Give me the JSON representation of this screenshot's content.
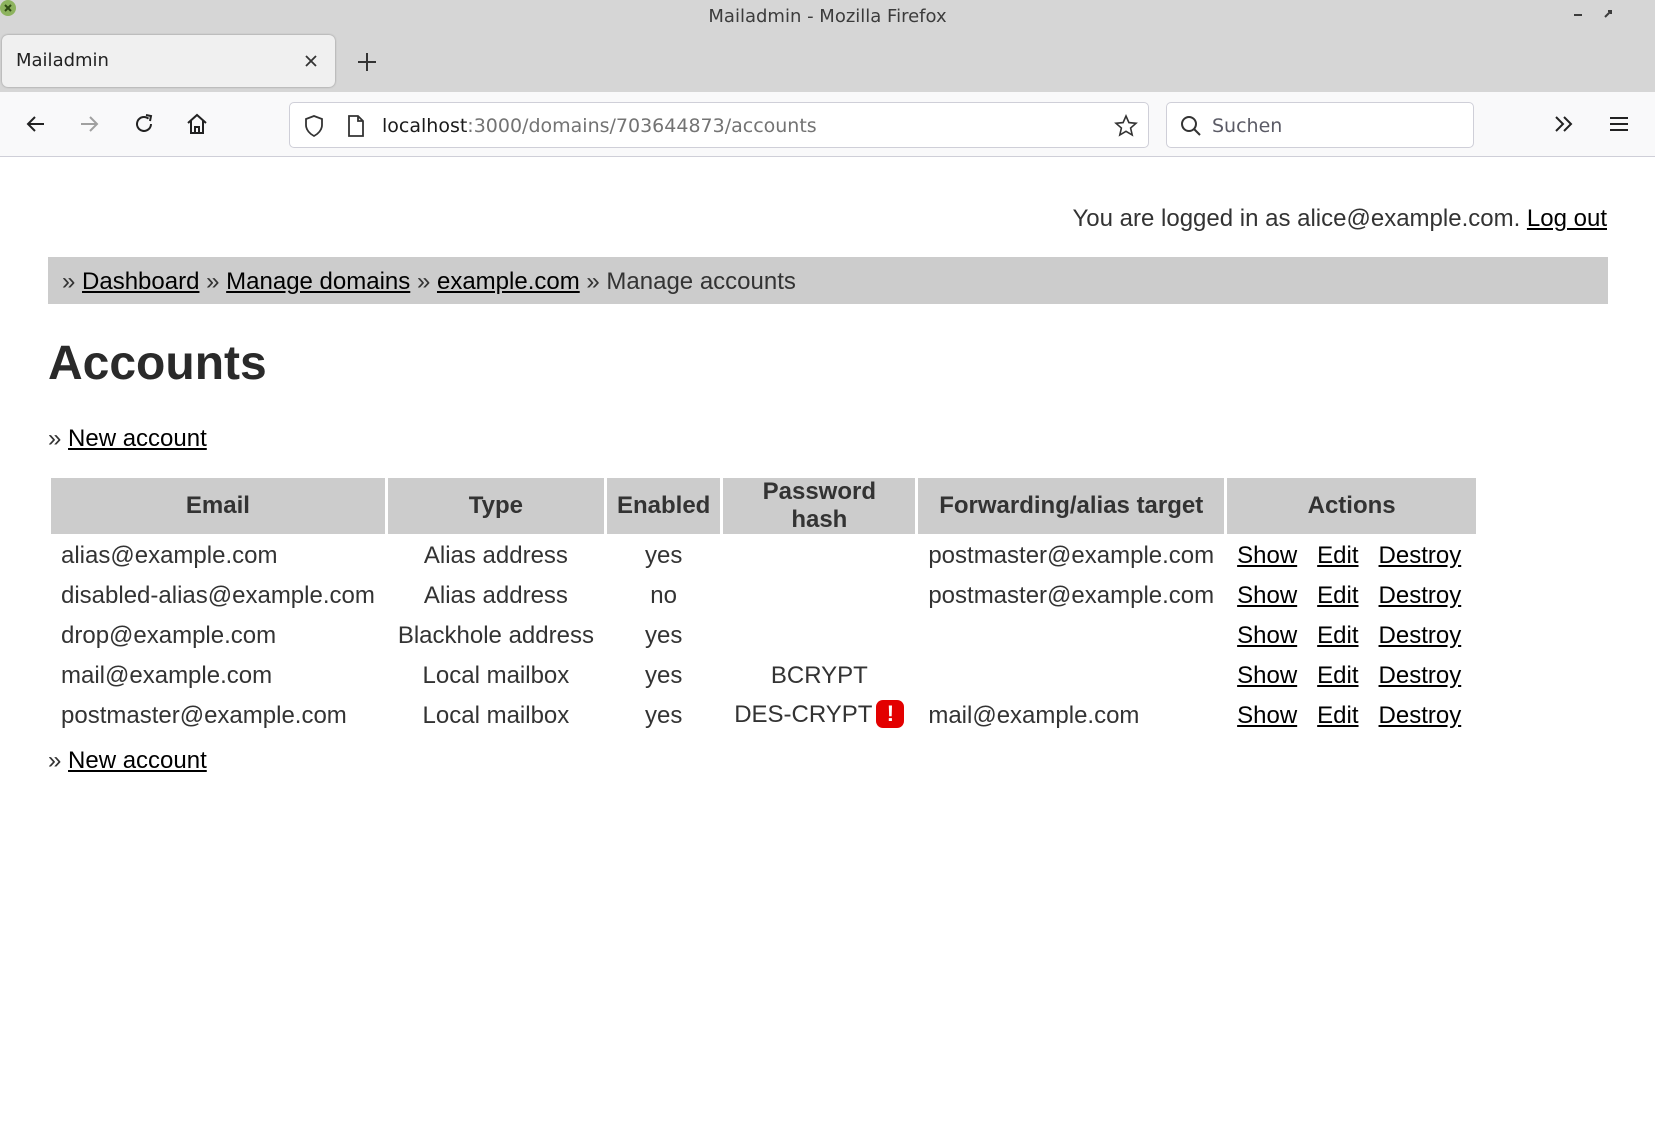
{
  "browser": {
    "window_title": "Mailadmin - Mozilla Firefox",
    "tab_title": "Mailadmin",
    "url_host": "localhost",
    "url_path": ":3000/domains/703644873/accounts",
    "search_placeholder": "Suchen"
  },
  "header": {
    "login_text": "You are logged in as alice@example.com.",
    "logout_label": "Log out"
  },
  "breadcrumb": {
    "sep": "»",
    "dashboard": "Dashboard",
    "manage_domains": "Manage domains",
    "domain": "example.com",
    "current": "Manage accounts"
  },
  "page": {
    "title": "Accounts",
    "new_account_label": "New account",
    "bullet": "»"
  },
  "table": {
    "headers": [
      "Email",
      "Type",
      "Enabled",
      "Password hash",
      "Forwarding/alias target",
      "Actions"
    ],
    "action_labels": {
      "show": "Show",
      "edit": "Edit",
      "destroy": "Destroy"
    },
    "rows": [
      {
        "email": "alias@example.com",
        "type": "Alias address",
        "enabled": "yes",
        "hash": "",
        "target": "postmaster@example.com",
        "warn": ""
      },
      {
        "email": "disabled-alias@example.com",
        "type": "Alias address",
        "enabled": "no",
        "hash": "",
        "target": "postmaster@example.com",
        "warn": ""
      },
      {
        "email": "drop@example.com",
        "type": "Blackhole address",
        "enabled": "yes",
        "hash": "",
        "target": "",
        "warn": ""
      },
      {
        "email": "mail@example.com",
        "type": "Local mailbox",
        "enabled": "yes",
        "hash": "BCRYPT",
        "target": "",
        "warn": ""
      },
      {
        "email": "postmaster@example.com",
        "type": "Local mailbox",
        "enabled": "yes",
        "hash": "DES-CRYPT",
        "target": "mail@example.com",
        "warn": "!"
      }
    ]
  },
  "colors": {
    "breadcrumb_bg": "#cccccc",
    "header_bg": "#cccccc",
    "warning": "#e30000"
  }
}
